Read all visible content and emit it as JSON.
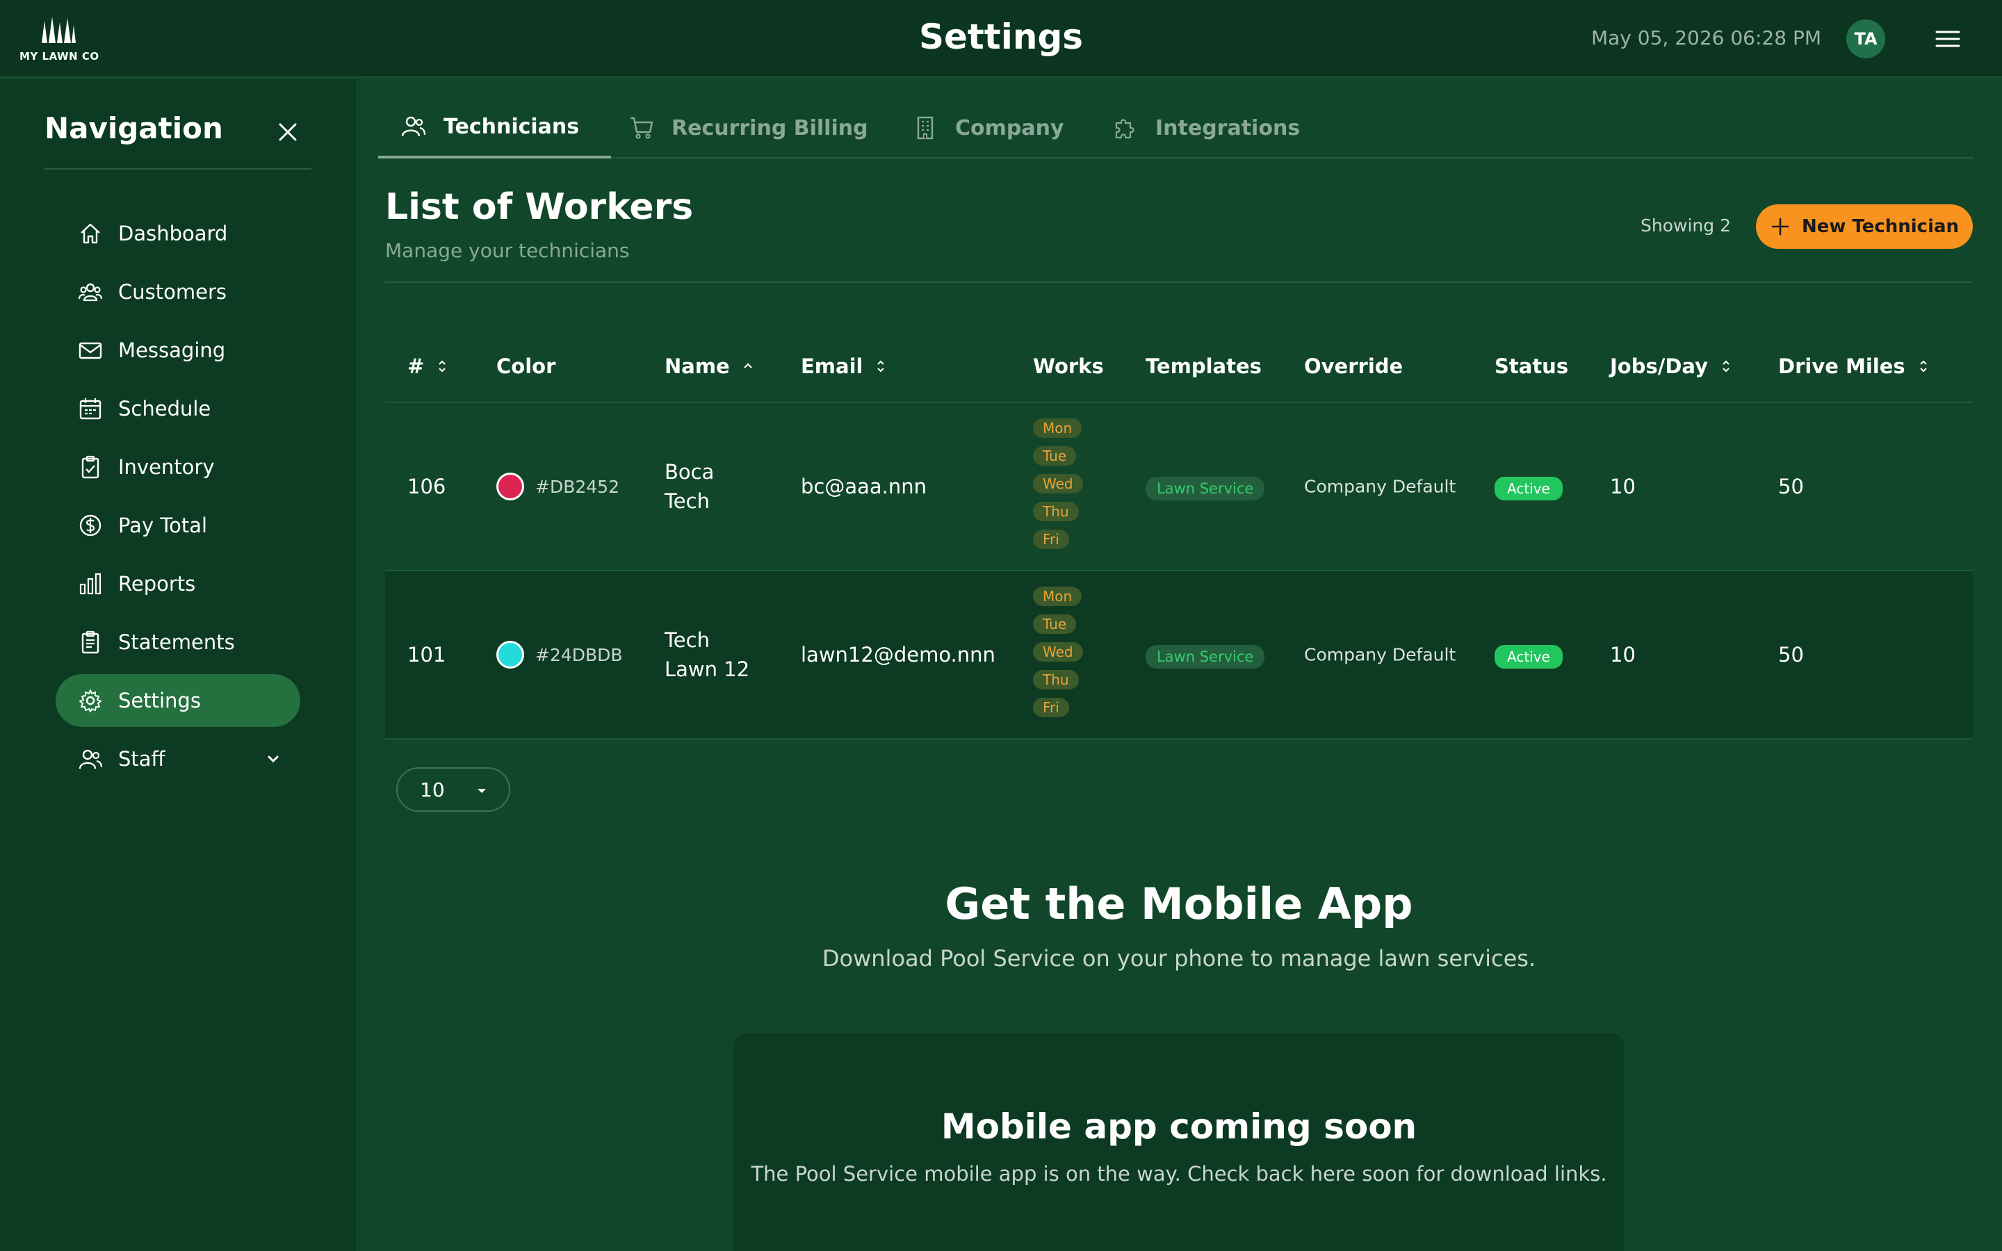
{
  "brand": {
    "logo_text": "MY LAWN CO"
  },
  "header": {
    "title": "Settings",
    "datetime": "May 05, 2026 06:28 PM",
    "avatar_initials": "TA"
  },
  "sidebar": {
    "title": "Navigation",
    "items": [
      {
        "label": "Dashboard",
        "icon": "home-icon"
      },
      {
        "label": "Customers",
        "icon": "users-icon"
      },
      {
        "label": "Messaging",
        "icon": "mail-icon"
      },
      {
        "label": "Schedule",
        "icon": "calendar-icon"
      },
      {
        "label": "Inventory",
        "icon": "clipboard-check-icon"
      },
      {
        "label": "Pay Total",
        "icon": "dollar-circle-icon"
      },
      {
        "label": "Reports",
        "icon": "bar-chart-icon"
      },
      {
        "label": "Statements",
        "icon": "document-list-icon"
      },
      {
        "label": "Settings",
        "icon": "gear-icon",
        "active": true
      },
      {
        "label": "Staff",
        "icon": "user-group-icon",
        "expandable": true
      }
    ]
  },
  "tabs": [
    {
      "label": "Technicians",
      "icon": "users-icon",
      "active": true
    },
    {
      "label": "Recurring Billing",
      "icon": "cart-icon"
    },
    {
      "label": "Company",
      "icon": "building-icon"
    },
    {
      "label": "Integrations",
      "icon": "puzzle-icon"
    }
  ],
  "list": {
    "title": "List of Workers",
    "subtitle": "Manage your technicians",
    "showing": "Showing 2",
    "new_button": "New Technician"
  },
  "table": {
    "columns": [
      "#",
      "Color",
      "Name",
      "Email",
      "Works",
      "Templates",
      "Override",
      "Status",
      "Jobs/Day",
      "Drive Miles"
    ],
    "rows": [
      {
        "id": "106",
        "color_hex": "#DB2452",
        "name_line1": "Boca",
        "name_line2": "Tech",
        "email": "bc@aaa.nnn",
        "works": [
          "Mon",
          "Tue",
          "Wed",
          "Thu",
          "Fri"
        ],
        "template": "Lawn Service",
        "override": "Company Default",
        "status": "Active",
        "jobs_per_day": "10",
        "drive_miles": "50"
      },
      {
        "id": "101",
        "color_hex": "#24DBDB",
        "name_line1": "Tech",
        "name_line2": "Lawn 12",
        "email": "lawn12@demo.nnn",
        "works": [
          "Mon",
          "Tue",
          "Wed",
          "Thu",
          "Fri"
        ],
        "template": "Lawn Service",
        "override": "Company Default",
        "status": "Active",
        "jobs_per_day": "10",
        "drive_miles": "50"
      }
    ]
  },
  "pagination": {
    "per_page": "10"
  },
  "mobile": {
    "title": "Get the Mobile App",
    "subtitle": "Download Pool Service on your phone to manage lawn services.",
    "card_title": "Mobile app coming soon",
    "card_text": "The Pool Service mobile app is on the way. Check back here soon for download links."
  },
  "colors": {
    "accent": "#f7931e",
    "status_active": "#22c55e",
    "background": "#11462a",
    "sidebar": "#0d3a22"
  }
}
